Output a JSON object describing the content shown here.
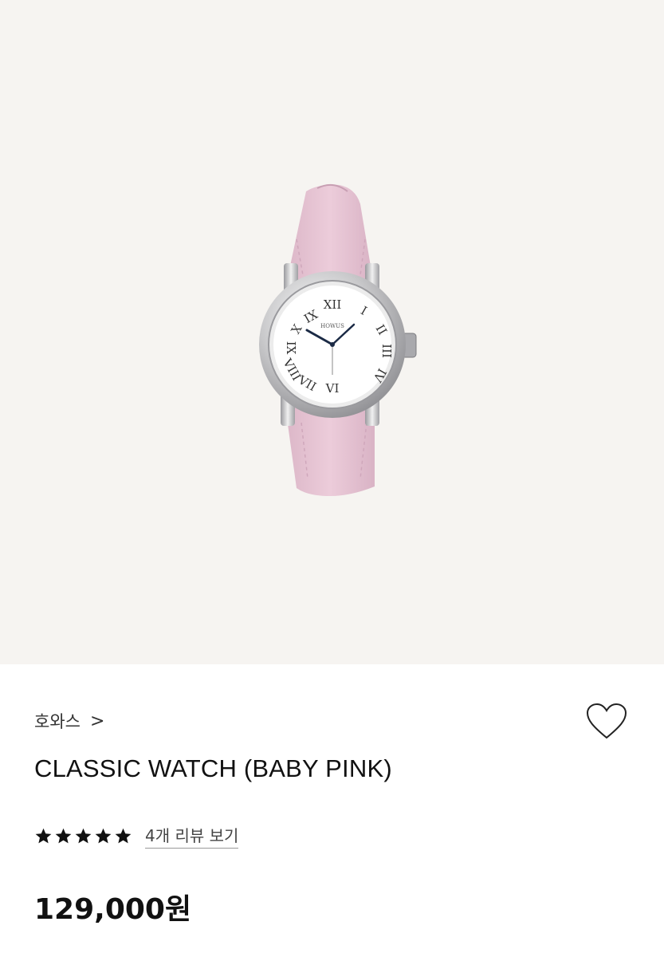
{
  "product": {
    "image_alt": "HOWUS classic watch baby pink",
    "dial_brand": "HOWUS",
    "brand": "호와스",
    "brand_chevron": ">",
    "title": "CLASSIC WATCH (BABY PINK)",
    "rating_stars": 5,
    "review_link": "4개 리뷰 보기",
    "price": "129,000원"
  },
  "colors": {
    "hero_bg": "#f6f4f1",
    "strap": "#e8c6d6",
    "star": "#111111"
  },
  "icons": {
    "like": "heart-outline-icon",
    "star": "star-filled-icon",
    "chevron": "chevron-right-icon"
  }
}
